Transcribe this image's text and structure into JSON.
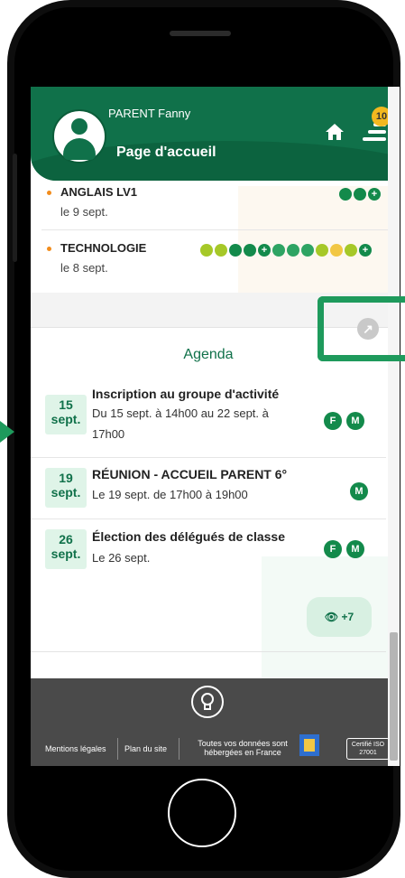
{
  "header": {
    "user_name": "PARENT Fanny",
    "page_title": "Page d'accueil",
    "notifications_count": "10"
  },
  "evaluations": [
    {
      "subject": "ANGLAIS LV1",
      "date": "le 9 sept."
    },
    {
      "subject": "TECHNOLOGIE",
      "date": "le 8 sept."
    }
  ],
  "agenda": {
    "title": "Agenda",
    "events": [
      {
        "day": "15",
        "month": "sept.",
        "title": "Inscription au groupe d'activité",
        "when_line1": "Du 15 sept. à 14h00 au 22 sept. à",
        "when_line2": "17h00",
        "tags": [
          "F",
          "M"
        ]
      },
      {
        "day": "19",
        "month": "sept.",
        "title": "RÉUNION - ACCUEIL PARENT 6°",
        "when_line1": "Le 19 sept. de 17h00 à 19h00",
        "tags": [
          "M"
        ]
      },
      {
        "day": "26",
        "month": "sept.",
        "title": "Élection des délégués de classe",
        "when_line1": "Le 26 sept.",
        "tags": [
          "F",
          "M"
        ]
      }
    ],
    "more_label": "+7"
  },
  "footer": {
    "legal": "Mentions légales",
    "sitemap": "Plan du site",
    "hosting_line1": "Toutes vos données sont",
    "hosting_line2": "hébergées en France",
    "iso_line1": "Certifié ISO",
    "iso_line2": "27001"
  },
  "colors": {
    "brand_green": "#10714a",
    "dot_green": "#138a4b",
    "dot_lime": "#a6c828",
    "dot_yellow": "#f2c744",
    "badge_yellow": "#f2b81f"
  }
}
